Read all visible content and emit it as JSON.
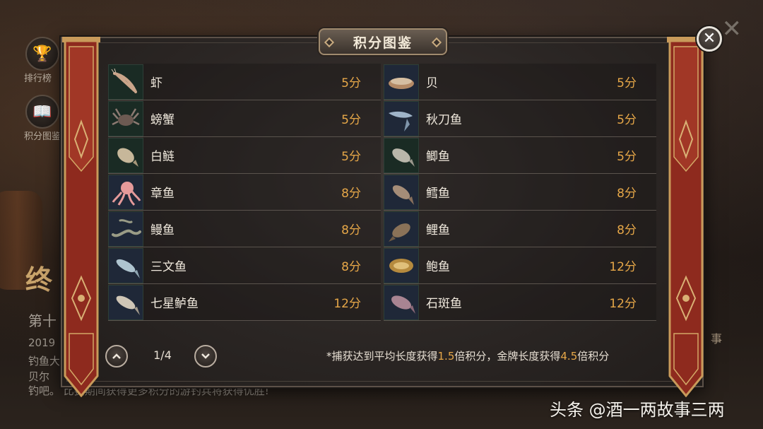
{
  "background": {
    "side_buttons": [
      {
        "label": "排行榜",
        "icon": "trophy-icon"
      },
      {
        "label": "积分图鉴",
        "icon": "book-icon"
      }
    ],
    "big_title": "终",
    "sub_title": "第十",
    "lines": [
      "2019",
      "钓鱼大",
      "贝尔",
      "钓吧。 比赛期间获得更多积分的游钓兵将获得优胜!"
    ],
    "right_text": "事",
    "close_x": "✕"
  },
  "dialog": {
    "title": "积分图鉴",
    "close_label": "✕",
    "left_column": [
      {
        "name": "虾",
        "points": "5分",
        "icon": "shrimp-icon"
      },
      {
        "name": "螃蟹",
        "points": "5分",
        "icon": "crab-icon"
      },
      {
        "name": "白鲢",
        "points": "5分",
        "icon": "silver-carp-icon"
      },
      {
        "name": "章鱼",
        "points": "8分",
        "icon": "octopus-icon"
      },
      {
        "name": "鳗鱼",
        "points": "8分",
        "icon": "eel-icon"
      },
      {
        "name": "三文鱼",
        "points": "8分",
        "icon": "salmon-icon"
      },
      {
        "name": "七星鲈鱼",
        "points": "12分",
        "icon": "sea-bass-icon"
      }
    ],
    "right_column": [
      {
        "name": "贝",
        "points": "5分",
        "icon": "shell-icon"
      },
      {
        "name": "秋刀鱼",
        "points": "5分",
        "icon": "saury-icon"
      },
      {
        "name": "鲫鱼",
        "points": "5分",
        "icon": "crucian-carp-icon"
      },
      {
        "name": "鳕鱼",
        "points": "8分",
        "icon": "cod-icon"
      },
      {
        "name": "鲤鱼",
        "points": "8分",
        "icon": "carp-icon"
      },
      {
        "name": "鲍鱼",
        "points": "12分",
        "icon": "abalone-icon"
      },
      {
        "name": "石斑鱼",
        "points": "12分",
        "icon": "grouper-icon"
      }
    ],
    "pager": {
      "current": "1/4",
      "up_icon": "chevron-up-icon",
      "down_icon": "chevron-down-icon"
    },
    "hint": {
      "prefix": "*捕获达到平均长度获得",
      "avg_multiplier": "1.5",
      "middle": "倍积分，金牌长度获得",
      "gold_multiplier": "4.5",
      "suffix": "倍积分"
    }
  },
  "watermark": "头条 @酒一两故事三两",
  "colors": {
    "accent_orange": "#e6a748",
    "banner_red": "#8e2a1e",
    "banner_gold": "#c89a5a"
  }
}
